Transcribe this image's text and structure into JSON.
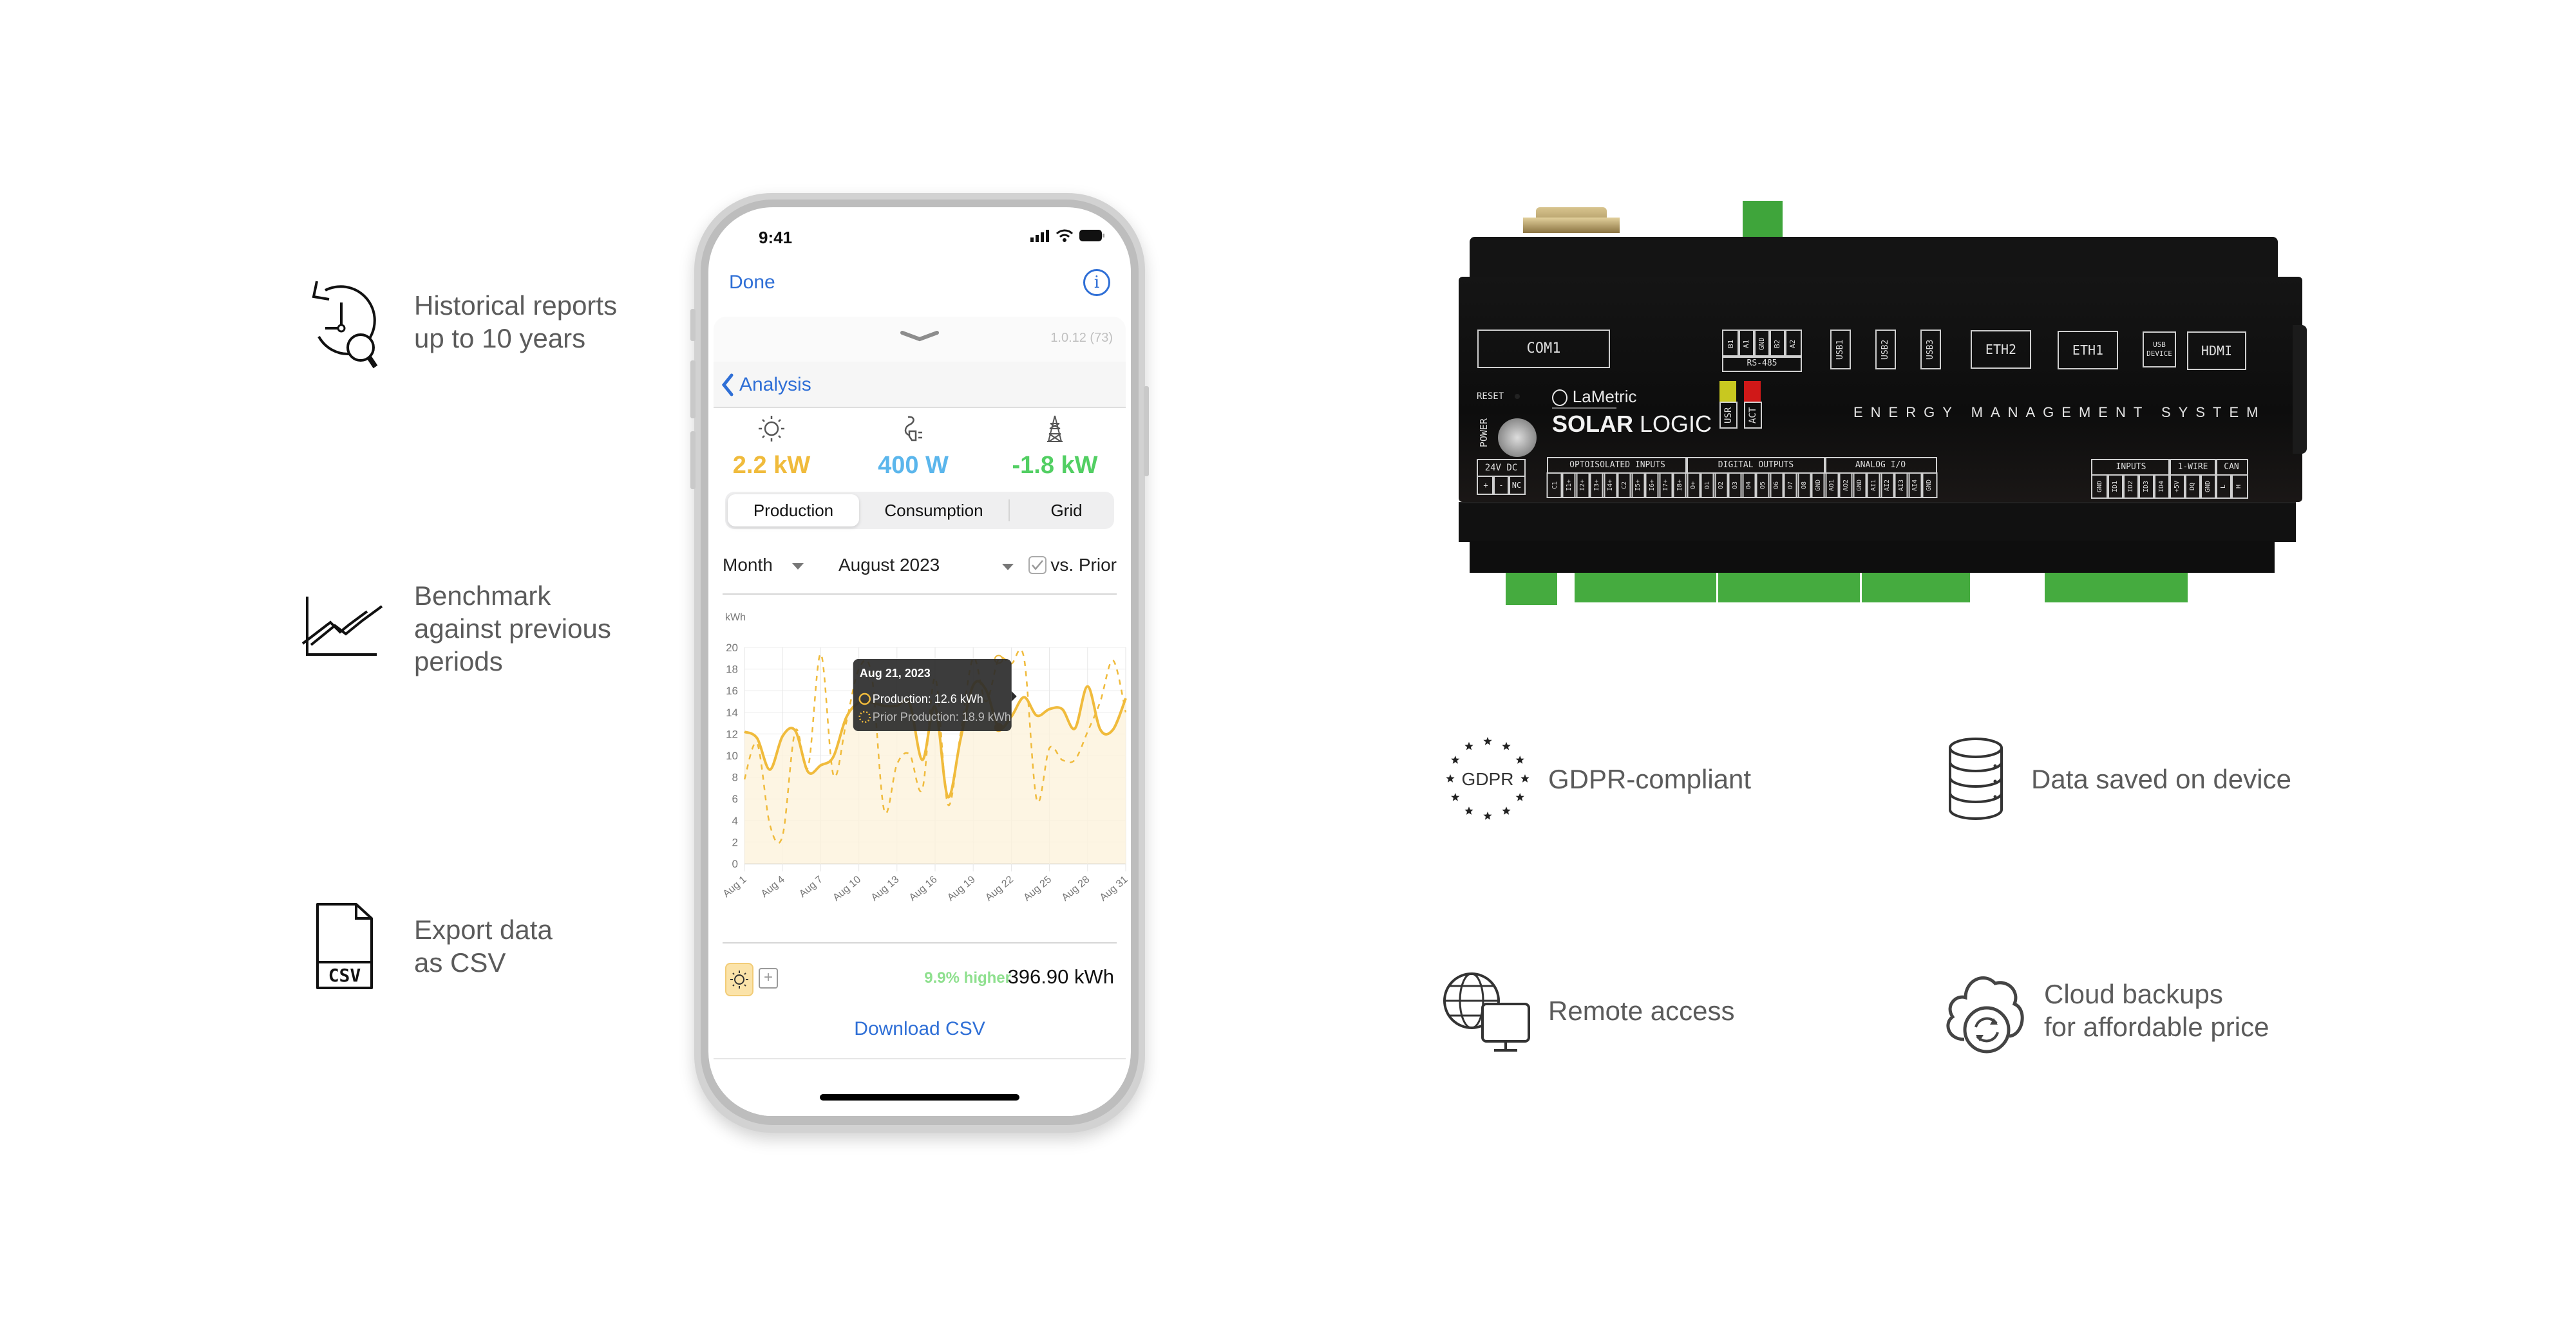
{
  "left_features": [
    {
      "icon": "history-search-icon",
      "text": "Historical reports\nup to 10 years"
    },
    {
      "icon": "benchmark-chart-icon",
      "text": "Benchmark\nagainst previous\nperiods"
    },
    {
      "icon": "csv-file-icon",
      "text": "Export data\nas CSV"
    }
  ],
  "phone": {
    "status": {
      "time": "9:41",
      "icons": [
        "signal-icon",
        "wifi-icon",
        "battery-icon"
      ]
    },
    "nav": {
      "done_label": "Done",
      "info_label": "i"
    },
    "version": "1.0.12 (73)",
    "back_label": "Analysis",
    "metrics": [
      {
        "icon": "sun-icon",
        "value": "2.2 kW",
        "color": "#f0bb3c"
      },
      {
        "icon": "plug-icon",
        "value": "400 W",
        "color": "#5bb6ec"
      },
      {
        "icon": "power-tower-icon",
        "value": "-1.8 kW",
        "color": "#52cf63"
      }
    ],
    "segments": [
      {
        "label": "Production",
        "selected": true
      },
      {
        "label": "Consumption",
        "selected": false
      },
      {
        "label": "Grid",
        "selected": false
      }
    ],
    "filters": {
      "period": "Month",
      "month": "August 2023",
      "compare_label": "vs. Prior",
      "compare_checked": true
    },
    "summary": {
      "change": "9.9% higher",
      "total": "396.90 kWh",
      "change_color": "#8fe08f"
    },
    "download_label": "Download CSV"
  },
  "chart_data": {
    "type": "line",
    "ylabel": "kWh",
    "ylim": [
      0,
      20
    ],
    "yticks": [
      0,
      2,
      4,
      6,
      8,
      10,
      12,
      14,
      16,
      18,
      20
    ],
    "xticks": [
      "Aug 1",
      "Aug 4",
      "Aug 7",
      "Aug 10",
      "Aug 13",
      "Aug 16",
      "Aug 19",
      "Aug 22",
      "Aug 25",
      "Aug 28",
      "Aug 31"
    ],
    "x": [
      1,
      2,
      3,
      4,
      5,
      6,
      7,
      8,
      9,
      10,
      11,
      12,
      13,
      14,
      15,
      16,
      17,
      18,
      19,
      20,
      21,
      22,
      23,
      24,
      25,
      26,
      27,
      28,
      29,
      30,
      31
    ],
    "grid": true,
    "series": [
      {
        "name": "Production",
        "style": "solid",
        "fill": true,
        "color": "#f0bb3c",
        "values": [
          12.2,
          11.6,
          8.7,
          11.8,
          12.3,
          8.5,
          9.1,
          9.9,
          13.5,
          14.9,
          14.9,
          14.6,
          14.6,
          14.8,
          9.6,
          14.5,
          6.2,
          11.5,
          16.5,
          16.1,
          12.6,
          13.6,
          15.4,
          13.7,
          14.3,
          14.3,
          12.5,
          16.4,
          12.4,
          12.4,
          15.3
        ]
      },
      {
        "name": "Prior Production",
        "style": "dashed",
        "fill": false,
        "color": "#f0bb3c",
        "values": [
          7.8,
          11.1,
          3.6,
          2.6,
          12.3,
          8.9,
          19.4,
          8.2,
          13.0,
          18.0,
          17.5,
          4.9,
          9.2,
          10.1,
          6.9,
          17.2,
          5.5,
          12.0,
          19.0,
          15.0,
          18.9,
          18.5,
          19.0,
          5.9,
          10.7,
          9.6,
          9.6,
          12.2,
          15.0,
          18.8,
          14.0
        ]
      }
    ],
    "tooltip": {
      "title": "Aug 21, 2023",
      "lines": [
        "Production: 12.6 kWh",
        "Prior Production: 18.9 kWh"
      ],
      "index": 20
    }
  },
  "device": {
    "brand": "LaMetric",
    "product_bold": "SOLAR",
    "product_light": "LOGIC",
    "subtitle": "ENERGY MANAGEMENT SYSTEM",
    "top_ports": {
      "com1": "COM1",
      "usb": [
        "USB1",
        "USB2",
        "USB3"
      ],
      "eth2": "ETH2",
      "eth1": "ETH1",
      "usb_device": "USB\nDEVICE",
      "hdmi": "HDMI"
    },
    "rs485": {
      "pins": [
        "B1",
        "A1",
        "GND",
        "B2",
        "A2"
      ],
      "label": "RS-485"
    },
    "leds": [
      {
        "label": "USR",
        "color": "#c8c820"
      },
      {
        "label": "ACT",
        "color": "#d01818"
      }
    ],
    "reset_label": "RESET",
    "power_label": "POWER",
    "power_in": {
      "label": "24V DC",
      "pins": [
        "+",
        "-",
        "NC"
      ]
    },
    "groups": [
      {
        "label": "OPTOISOLATED INPUTS",
        "pins": [
          "C1",
          "I1+",
          "I2+",
          "I3+",
          "I4+",
          "C2",
          "I5+",
          "I6+",
          "I7+",
          "I8+"
        ]
      },
      {
        "label": "DIGITAL OUTPUTS",
        "pins": [
          "O+",
          "O1",
          "O2",
          "O3",
          "O4",
          "O5",
          "O6",
          "O7",
          "O8",
          "GND"
        ]
      },
      {
        "label": "ANALOG I/O",
        "pins": [
          "AO1",
          "AO2",
          "GND",
          "AI1",
          "AI2",
          "AI3",
          "AI4",
          "GND"
        ]
      }
    ],
    "right_groups": [
      {
        "label": "INPUTS",
        "pins": [
          "GND",
          "ID1",
          "ID2",
          "ID3",
          "ID4"
        ]
      },
      {
        "label": "1-WIRE",
        "pins": [
          "+5V",
          "DQ",
          "GND"
        ]
      },
      {
        "label": "CAN",
        "pins": [
          "L",
          "H"
        ]
      }
    ]
  },
  "right_features": [
    {
      "icon": "gdpr-icon",
      "icon_text": "GDPR",
      "text": "GDPR-compliant"
    },
    {
      "icon": "database-icon",
      "text": "Data saved on device"
    },
    {
      "icon": "remote-access-icon",
      "text": "Remote access"
    },
    {
      "icon": "cloud-backup-icon",
      "text": "Cloud backups\nfor affordable price"
    }
  ]
}
